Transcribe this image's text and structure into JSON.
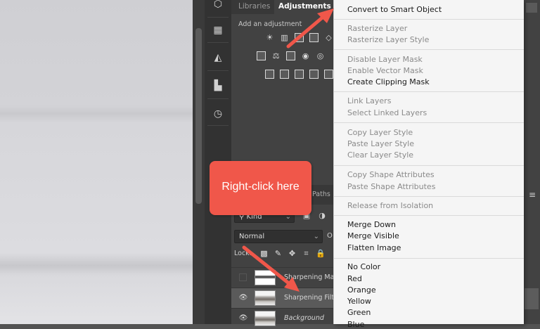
{
  "panel": {
    "tabs": [
      "Libraries",
      "Adjustments"
    ],
    "adjustments_title": "Add an adjustment",
    "adjustment_icons_row1": [
      "☀",
      "▥",
      "◪",
      "◩"
    ],
    "adjustment_icons_row2": [
      "▦",
      "⚖",
      "◧",
      "◉",
      "◎"
    ],
    "adjustment_icons_row3": [
      "◩",
      "◩",
      "◩",
      "◩",
      "◩"
    ],
    "layers_tab_partial": "Paths",
    "kind_filter": "Kind",
    "blend_mode": "Normal",
    "lock_label": "Lock:"
  },
  "layers": [
    {
      "name": "Sharpening Mas",
      "visible": false,
      "selected": false,
      "thumb": "mask",
      "italic": false
    },
    {
      "name": "Sharpening Filte",
      "visible": true,
      "selected": true,
      "thumb": "photo",
      "italic": false
    },
    {
      "name": "Background",
      "visible": true,
      "selected": false,
      "thumb": "photo",
      "italic": true
    }
  ],
  "context_menu": {
    "groups": [
      [
        {
          "label": "Convert to Smart Object",
          "enabled": true
        }
      ],
      [
        {
          "label": "Rasterize Layer",
          "enabled": false
        },
        {
          "label": "Rasterize Layer Style",
          "enabled": false
        }
      ],
      [
        {
          "label": "Disable Layer Mask",
          "enabled": false
        },
        {
          "label": "Enable Vector Mask",
          "enabled": false
        },
        {
          "label": "Create Clipping Mask",
          "enabled": true
        }
      ],
      [
        {
          "label": "Link Layers",
          "enabled": false
        },
        {
          "label": "Select Linked Layers",
          "enabled": false
        }
      ],
      [
        {
          "label": "Copy Layer Style",
          "enabled": false
        },
        {
          "label": "Paste Layer Style",
          "enabled": false
        },
        {
          "label": "Clear Layer Style",
          "enabled": false
        }
      ],
      [
        {
          "label": "Copy Shape Attributes",
          "enabled": false
        },
        {
          "label": "Paste Shape Attributes",
          "enabled": false
        }
      ],
      [
        {
          "label": "Release from Isolation",
          "enabled": false
        }
      ],
      [
        {
          "label": "Merge Down",
          "enabled": true
        },
        {
          "label": "Merge Visible",
          "enabled": true
        },
        {
          "label": "Flatten Image",
          "enabled": true
        }
      ],
      [
        {
          "label": "No Color",
          "enabled": true
        },
        {
          "label": "Red",
          "enabled": true
        },
        {
          "label": "Orange",
          "enabled": true
        },
        {
          "label": "Yellow",
          "enabled": true
        },
        {
          "label": "Green",
          "enabled": true
        },
        {
          "label": "Blue",
          "enabled": true
        }
      ]
    ]
  },
  "callout": {
    "text": "Right-click here"
  },
  "colors": {
    "callout": "#f0574a",
    "arrow": "#f0574a",
    "menu_bg": "#f5f5f5",
    "panel_bg": "#424242"
  }
}
